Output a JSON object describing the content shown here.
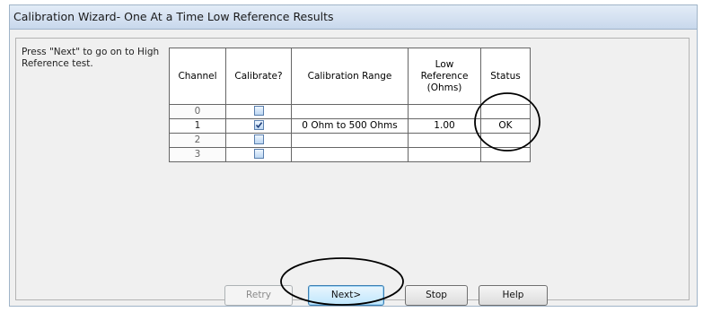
{
  "window": {
    "title": "Calibration Wizard- One At a Time Low Reference Results"
  },
  "instruction": "Press \"Next\" to go on to High Reference test.",
  "table": {
    "headers": {
      "channel": "Channel",
      "calibrate": "Calibrate?",
      "range": "Calibration Range",
      "lowref_line1": "Low",
      "lowref_line2": "Reference",
      "lowref_line3": "(Ohms)",
      "status": "Status"
    },
    "rows": [
      {
        "channel": "0",
        "checked": false,
        "range": "",
        "lowref": "",
        "status": ""
      },
      {
        "channel": "1",
        "checked": true,
        "range": "0 Ohm to 500 Ohms",
        "lowref": "1.00",
        "status": "OK"
      },
      {
        "channel": "2",
        "checked": false,
        "range": "",
        "lowref": "",
        "status": ""
      },
      {
        "channel": "3",
        "checked": false,
        "range": "",
        "lowref": "",
        "status": ""
      }
    ]
  },
  "buttons": {
    "retry": "Retry",
    "next": "Next>",
    "stop": "Stop",
    "help": "Help"
  }
}
